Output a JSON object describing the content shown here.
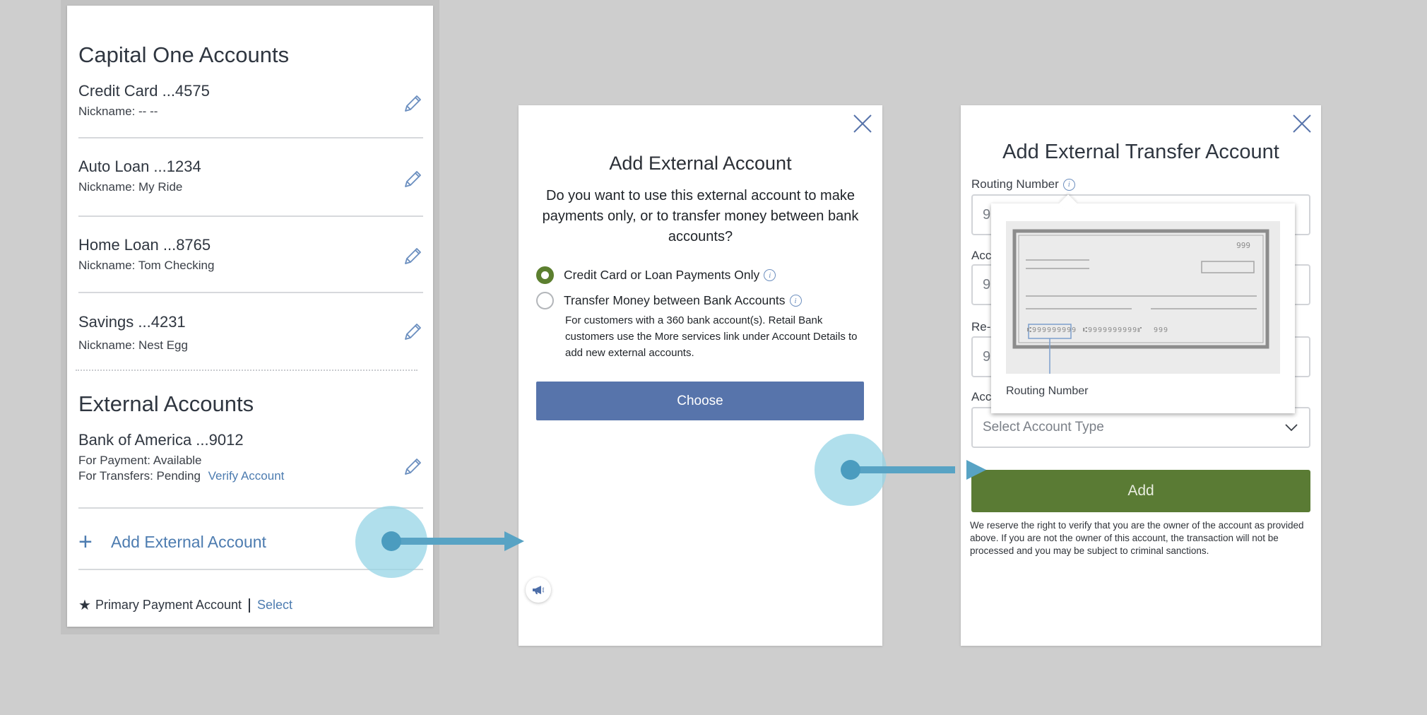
{
  "accounts_panel": {
    "capital_one_title": "Capital One Accounts",
    "accounts": [
      {
        "name": "Credit Card ...4575",
        "nickname": "Nickname:  -- --"
      },
      {
        "name": "Auto Loan ...1234",
        "nickname": "Nickname: My Ride"
      },
      {
        "name": "Home Loan ...8765",
        "nickname": "Nickname: Tom Checking"
      },
      {
        "name": "Savings ...4231",
        "nickname": "Nickname: Nest Egg"
      }
    ],
    "external_title": "External Accounts",
    "external_account": {
      "name": "Bank of America ...9012",
      "payment_status": "For Payment: Available",
      "transfer_status": "For Transfers: Pending",
      "verify_link": "Verify Account"
    },
    "add_external_label": "Add External Account",
    "primary_payment_label": "Primary Payment Account",
    "select_link": "Select"
  },
  "add_external_dialog": {
    "title": "Add External Account",
    "question": "Do you want to use this external account to make payments only, or to transfer money between bank accounts?",
    "option_payments": "Credit Card or Loan Payments Only",
    "option_transfer": "Transfer Money between Bank Accounts",
    "transfer_description": "For customers with a 360 bank account(s). Retail Bank customers use the More services link under Account Details to add new external accounts.",
    "choose_button": "Choose",
    "selected_option": "option_payments"
  },
  "transfer_dialog": {
    "title": "Add External Transfer Account",
    "routing_label": "Routing Number",
    "account_label_partial": "Acco",
    "reenter_label_partial": "Re-E",
    "account_type_label_partial": "Acc",
    "field_placeholder_partial": "9",
    "account_type_placeholder": "Select  Account Type",
    "add_button": "Add",
    "disclaimer": "We reserve the right to verify that you are the owner of the account as provided above. If you are not the owner of this account, the transaction will not be processed and you may be subject to criminal sanctions.",
    "tooltip": {
      "label": "Routing Number",
      "check_number": "999",
      "routing_digits": "⑆999999999",
      "account_digits": "⑆9999999999⑈",
      "check_digits": "999"
    }
  },
  "colors": {
    "link_blue": "#4d7cb0",
    "choose_blue": "#5774ab",
    "add_green": "#5a7b34",
    "radio_green": "#5c7f2f",
    "annotation_blue": "#58a3c4"
  }
}
